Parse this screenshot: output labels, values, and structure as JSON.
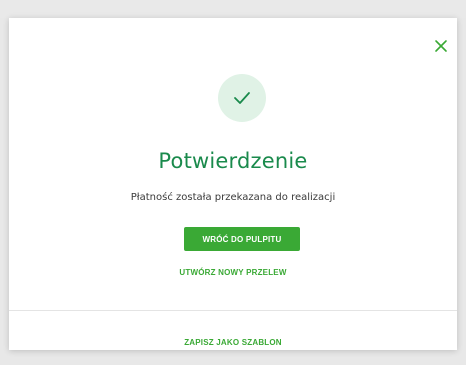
{
  "dialog": {
    "title": "Potwierdzenie",
    "message": "Płatność została przekazana do realizacji",
    "primary_button_label": "WRÓĆ DO PULPITU",
    "secondary_link_label": "UTWÓRZ NOWY PRZELEW",
    "footer_link_label": "ZAPISZ JAKO SZABLON",
    "close_icon": "close-icon",
    "status_icon": "check-icon"
  },
  "colors": {
    "accent": "#3aa935",
    "title": "#1a8a4c",
    "success_circle": "#e0f2e6"
  }
}
